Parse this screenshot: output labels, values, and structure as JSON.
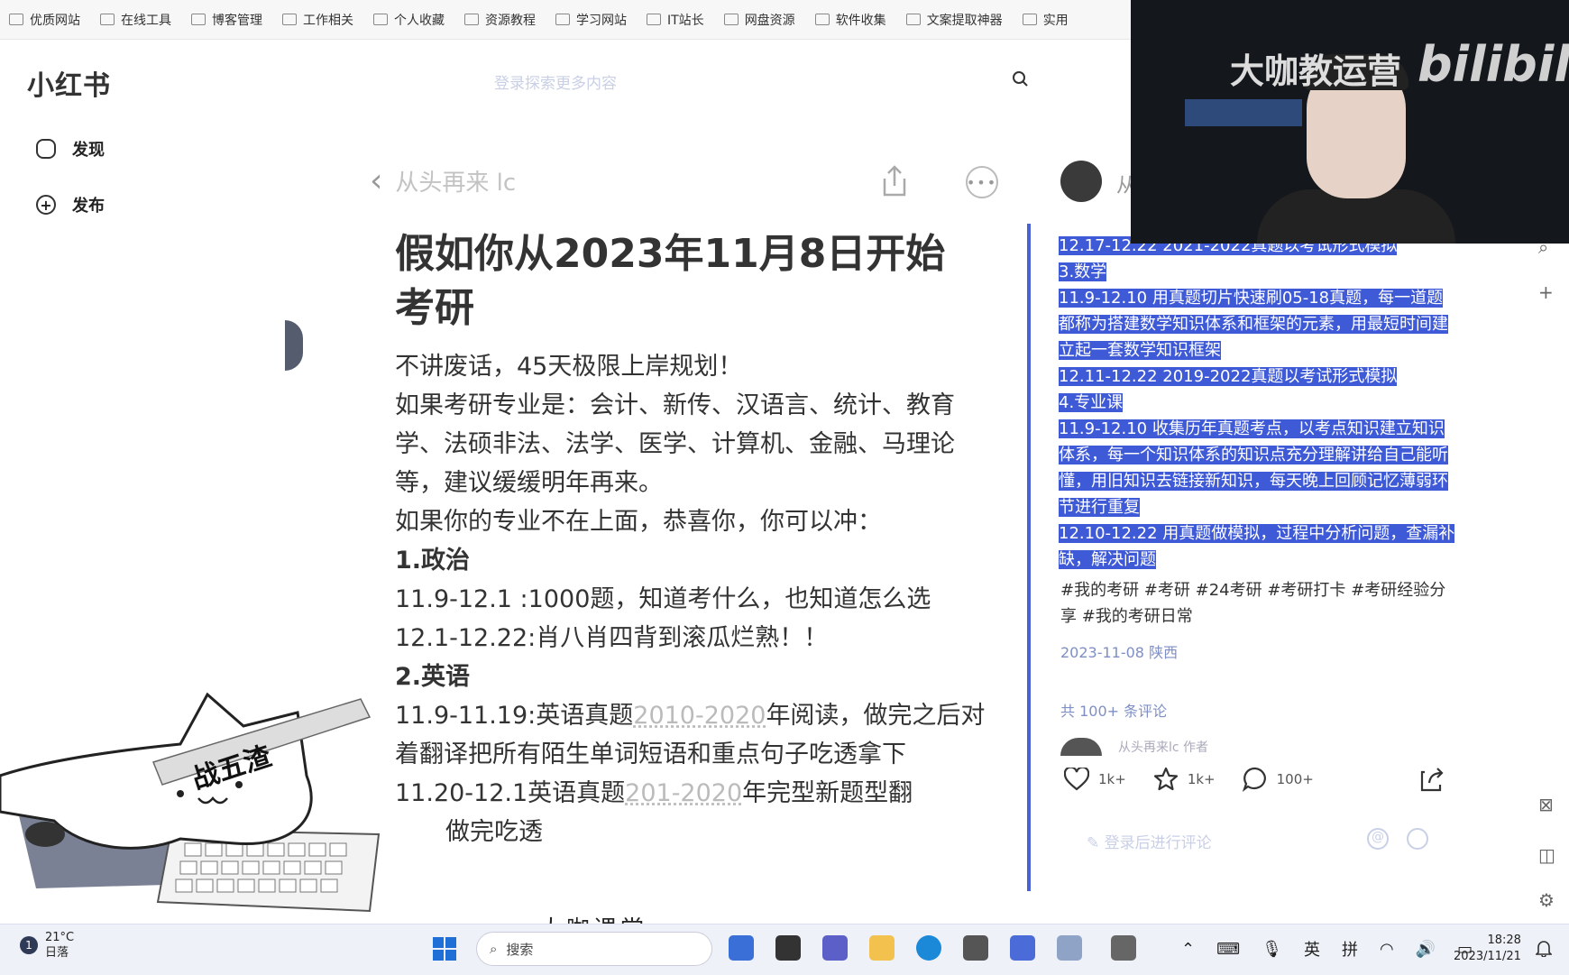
{
  "bookmarks": [
    "优质网站",
    "在线工具",
    "博客管理",
    "工作相关",
    "个人收藏",
    "资源教程",
    "学习网站",
    "IT站长",
    "网盘资源",
    "软件收集",
    "文案提取神器",
    "实用"
  ],
  "app": {
    "logo": "小红书",
    "search_placeholder": "登录探索更多内容"
  },
  "sidebar": {
    "items": [
      {
        "label": "发现",
        "icon": "home-icon"
      },
      {
        "label": "发布",
        "icon": "plus-icon"
      }
    ]
  },
  "note": {
    "author": "从头再来 lc",
    "title": "假如你从2023年11月8日开始考研",
    "lines": [
      {
        "text": "不讲废话，45天极限上岸规划！",
        "style": "normal"
      },
      {
        "text": "如果考研专业是：会计、新传、汉语言、统计、教育学、法硕非法、法学、医学、计算机、金融、马理论等，建议缓缓明年再来。",
        "style": "normal"
      },
      {
        "text": "如果你的专业不在上面，恭喜你，你可以冲：",
        "style": "normal"
      },
      {
        "text": "1.政治",
        "style": "heading"
      },
      {
        "text": "11.9-12.1 :1000题，知道考什么，也知道怎么选",
        "style": "normal"
      },
      {
        "text": "12.1-12.22:肖八肖四背到滚瓜烂熟！！",
        "style": "normal"
      },
      {
        "text": "2.英语",
        "style": "heading"
      },
      {
        "text": "11.9-11.19:英语真题",
        "style": "inline",
        "dim": "2010-2020",
        "rest": "年阅读，做完之后对着翻译把所有陌生单词短语和重点句子吃透拿下"
      },
      {
        "text": "11.20-12.1英语真题",
        "style": "inline",
        "dim": "201-2020",
        "rest": "年完型新题型翻"
      },
      {
        "text": "做完吃透",
        "style": "indent"
      }
    ]
  },
  "panel": {
    "author": "从",
    "highlighted": [
      "12.17-12.22 2021-2022真题以考试形式模拟",
      "3.数学",
      "11.9-12.10 用真题切片快速刷05-18真题，每一道题都称为搭建数学知识体系和框架的元素，用最短时间建立起一套数学知识框架",
      "12.11-12.22 2019-2022真题以考试形式模拟",
      "4.专业课",
      "11.9-12.10 收集历年真题考点，以考点知识建立知识体系，每一个知识体系的知识点充分理解讲给自己能听懂，用旧知识去链接新知识，每天晚上回顾记忆薄弱环节进行重复",
      "12.10-12.22 用真题做模拟，过程中分析问题，查漏补缺，解决问题"
    ],
    "tags": "#我的考研 #考研 #24考研 #考研打卡 #考研经验分享 #我的考研日常",
    "date": "2023-11-08 陕西",
    "comment_count": "共 100+ 条评论",
    "commenter": "从头再来lc 作者",
    "likes": "1k+",
    "stars": "1k+",
    "comments": "100+",
    "comment_placeholder": "登录后进行评论"
  },
  "webcam": {
    "watermark": "大咖教运营",
    "brand": "bilibili"
  },
  "overlay": {
    "cat_band": "战五渣",
    "caption": "大咖课堂"
  },
  "taskbar": {
    "temp": "21°C",
    "weather": "日落",
    "weather_badge": "1",
    "search": "搜索",
    "ime_lang": "英",
    "ime_mode": "拼",
    "time": "18:28",
    "date": "2023/11/21"
  }
}
